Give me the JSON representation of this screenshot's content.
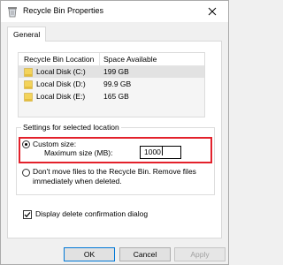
{
  "window": {
    "title": "Recycle Bin Properties",
    "icon": "recycle-bin-icon"
  },
  "tabs": [
    {
      "label": "General",
      "selected": true
    }
  ],
  "locations": {
    "headers": {
      "location": "Recycle Bin Location",
      "space": "Space Available"
    },
    "rows": [
      {
        "name": "Local Disk (C:)",
        "space": "199 GB",
        "selected": true
      },
      {
        "name": "Local Disk (D:)",
        "space": "99.9 GB",
        "selected": false
      },
      {
        "name": "Local Disk (E:)",
        "space": "165 GB",
        "selected": false
      }
    ]
  },
  "settings": {
    "legend": "Settings for selected location",
    "custom_size_label": "Custom size:",
    "custom_size_selected": true,
    "max_size_label": "Maximum size (MB):",
    "max_size_value": "1000",
    "dont_move_line1": "Don't move files to the Recycle Bin. Remove files",
    "dont_move_line2": "immediately when deleted.",
    "dont_move_selected": false
  },
  "confirm_dialog": {
    "label": "Display delete confirmation dialog",
    "checked": true
  },
  "buttons": {
    "ok": "OK",
    "cancel": "Cancel",
    "apply": "Apply",
    "apply_enabled": false
  },
  "colors": {
    "highlight": "#e3212b",
    "drive_icon": "#f3d35b",
    "ok_border": "#0078d7"
  }
}
